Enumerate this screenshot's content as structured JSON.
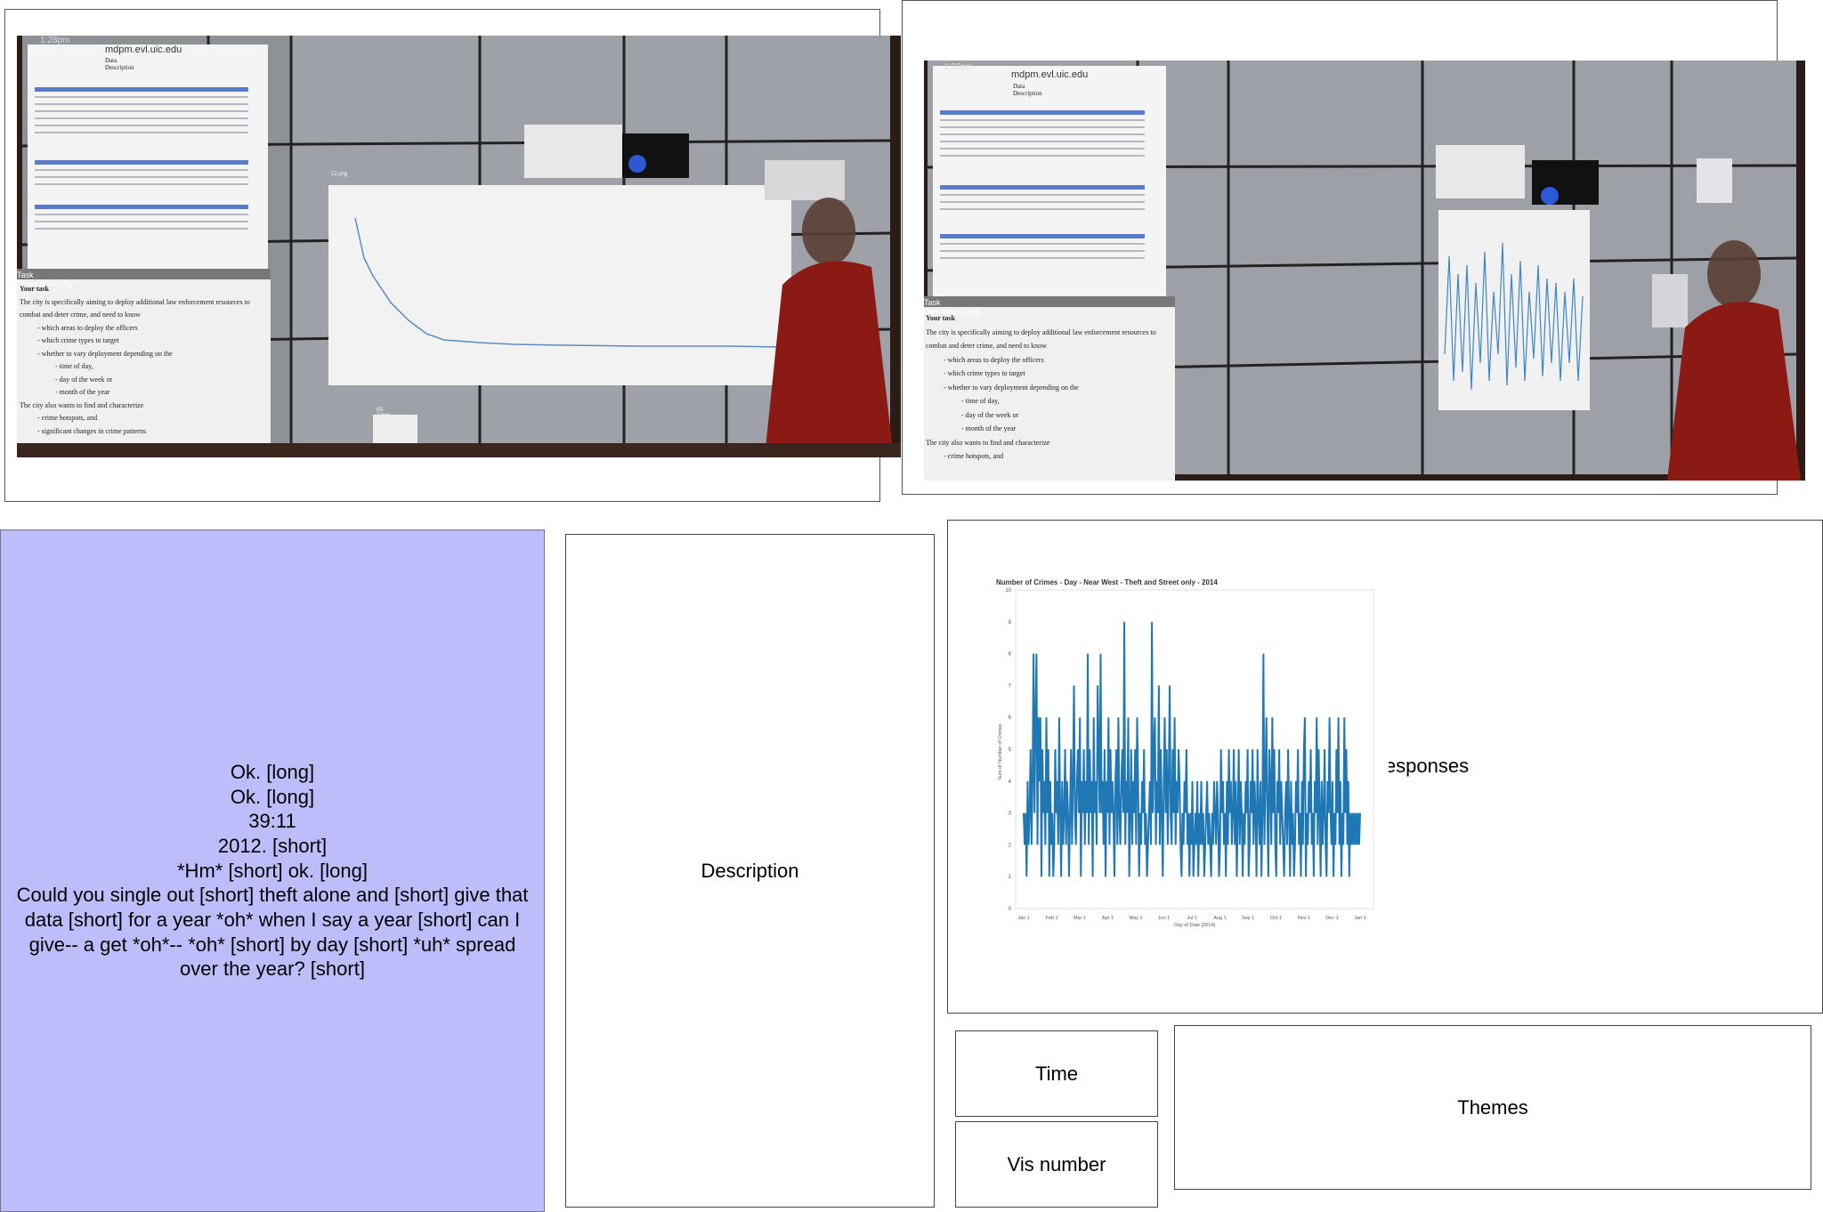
{
  "transcript": {
    "lines": [
      "Ok. [long]",
      "Ok. [long]",
      "39:11",
      "2012. [short]",
      "*Hm* [short] ok. [long]",
      "Could you single out [short] theft alone and [short] give that data [short] for a year *oh* when I say a year [short] can I give-- a get *oh*-- *oh* [short] by day [short] *uh* spread over the year? [short]"
    ]
  },
  "boxes": {
    "description": "Description",
    "responses": "Responses",
    "time": "Time",
    "vis_number": "Vis number",
    "themes": "Themes"
  },
  "photo1": {
    "clock": "1:28pm",
    "host": "mdpm.evl.uic.edu",
    "doc_title": "Data Description",
    "task_window": "Task Description.png",
    "task_heading": "Your task",
    "task_lines": [
      "The city is specifically aiming to deploy additional law enforcement resources to",
      "combat and deter crime, and need to know",
      "- which areas to deploy the officers",
      "- which crime types to target",
      "- whether to vary deployment depending on the",
      "- time of day,",
      "- day of the week or",
      "- month of the year",
      "The city also wants to find and characterize",
      "- crime hotspots, and",
      "- significant changes in crime patterns"
    ],
    "chart_window": "12.png",
    "small_window": "05-2.png"
  },
  "photo2": {
    "clock": "1:30pm",
    "host": "mdpm.evl.uic.edu",
    "doc_title": "Data Description",
    "task_window": "Task Description.png",
    "task_heading": "Your task",
    "task_lines": [
      "The city is specifically aiming to deploy additional law enforcement resources to",
      "combat and deter crime, and need to know",
      "- which areas to deploy the officers",
      "- which crime types to target",
      "- whether to vary deployment depending on the",
      "- time of day,",
      "- day of the week or",
      "- month of the year",
      "The city also wants to find and characterize",
      "- crime hotspots, and"
    ]
  },
  "chart_data": {
    "type": "line",
    "title": "Number of Crimes - Day - Near West - Theft and Street only - 2014",
    "xlabel": "Day of Date [2014]",
    "ylabel": "Sum of Number of Crimes",
    "x_ticks": [
      "Jan 1",
      "Feb 1",
      "Mar 1",
      "Apr 1",
      "May 1",
      "Jun 1",
      "Jul 1",
      "Aug 1",
      "Sep 1",
      "Oct 1",
      "Nov 1",
      "Dec 1",
      "Jan 1"
    ],
    "y_ticks": [
      0,
      1,
      2,
      3,
      4,
      5,
      6,
      7,
      8,
      9,
      10
    ],
    "ylim": [
      0,
      10
    ],
    "series_color": "#1f77b4",
    "values": [
      3,
      2,
      3,
      1,
      4,
      2,
      3,
      5,
      2,
      4,
      8,
      3,
      6,
      8,
      2,
      6,
      4,
      6,
      1,
      5,
      3,
      4,
      2,
      6,
      3,
      5,
      1,
      4,
      2,
      3,
      1,
      2,
      5,
      3,
      4,
      2,
      6,
      3,
      1,
      4,
      2,
      3,
      5,
      2,
      4,
      3,
      1,
      3,
      5,
      2,
      4,
      7,
      3,
      2,
      4,
      5,
      3,
      6,
      1,
      4,
      3,
      5,
      2,
      4,
      3,
      8,
      2,
      5,
      3,
      4,
      1,
      6,
      3,
      4,
      2,
      7,
      5,
      3,
      8,
      3,
      4,
      2,
      5,
      1,
      4,
      3,
      6,
      2,
      5,
      3,
      4,
      3,
      1,
      4,
      5,
      2,
      6,
      3,
      2,
      4,
      5,
      3,
      9,
      2,
      4,
      3,
      6,
      1,
      3,
      5,
      2,
      4,
      3,
      5,
      2,
      6,
      4,
      1,
      3,
      2,
      4,
      3,
      5,
      2,
      3,
      1,
      2,
      3,
      4,
      2,
      9,
      3,
      5,
      6,
      2,
      4,
      3,
      7,
      2,
      5,
      3,
      1,
      4,
      6,
      3,
      5,
      2,
      4,
      7,
      3,
      2,
      5,
      3,
      6,
      2,
      4,
      3,
      5,
      4,
      2,
      1,
      3,
      2,
      4,
      3,
      5,
      2,
      3,
      1,
      3,
      2,
      4,
      1,
      2,
      3,
      2,
      4,
      1,
      3,
      2,
      4,
      2,
      3,
      1,
      2,
      3,
      4,
      2,
      3,
      2,
      1,
      3,
      2,
      4,
      3,
      2,
      4,
      3,
      1,
      2,
      5,
      3,
      4,
      2,
      3,
      1,
      4,
      2,
      5,
      3,
      4,
      2,
      3,
      5,
      2,
      4,
      1,
      3,
      5,
      2,
      4,
      3,
      1,
      3,
      2,
      4,
      3,
      5,
      1,
      2,
      4,
      3,
      5,
      2,
      4,
      3,
      1,
      5,
      3,
      2,
      4,
      1,
      3,
      8,
      2,
      4,
      6,
      3,
      1,
      5,
      4,
      2,
      6,
      3,
      5,
      2,
      1,
      4,
      3,
      5,
      2,
      4,
      3,
      2,
      1,
      3,
      4,
      2,
      5,
      3,
      1,
      4,
      2,
      3,
      1,
      2,
      4,
      3,
      5,
      2,
      3,
      1,
      4,
      2,
      5,
      6,
      1,
      3,
      2,
      4,
      3,
      5,
      2,
      3,
      1,
      4,
      3,
      6,
      2,
      5,
      3,
      1,
      4,
      2,
      3,
      5,
      2,
      1,
      4,
      3,
      6,
      3,
      2,
      4,
      1,
      3,
      2,
      5,
      3,
      6,
      2,
      4,
      1,
      3,
      2,
      6,
      3,
      5,
      2,
      4,
      1,
      3,
      2,
      3,
      2,
      3,
      2,
      3,
      2,
      3,
      2,
      3
    ]
  }
}
